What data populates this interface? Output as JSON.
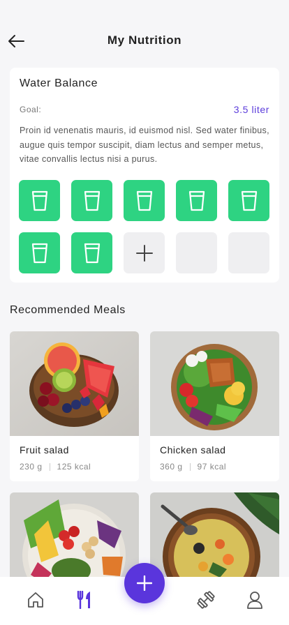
{
  "header": {
    "title": "My Nutrition",
    "back_icon": "arrow-left-icon"
  },
  "water": {
    "title": "Water Balance",
    "goal_label": "Goal:",
    "goal_value": "3.5 liter",
    "description": "Proin id venenatis mauris, id euismod nisl. Sed water finibus, augue quis tempor suscipit, diam lectus and semper metus, vitae convallis lectus nisi a purus.",
    "glasses_filled": 7,
    "glasses_total": 10,
    "add_icon": "plus-icon",
    "accent_color": "#2ed382",
    "goal_color": "#5b3cdb"
  },
  "meals": {
    "section_title": "Recommended Meals",
    "items": [
      {
        "name": "Fruit salad",
        "weight": "230 g",
        "calories": "125 kcal"
      },
      {
        "name": "Chicken salad",
        "weight": "360 g",
        "calories": "97 kcal"
      },
      {
        "name": "",
        "weight": "",
        "calories": ""
      },
      {
        "name": "",
        "weight": "",
        "calories": ""
      }
    ]
  },
  "nav": {
    "items": [
      "home-icon",
      "cutlery-icon",
      "dumbbell-icon",
      "user-icon"
    ],
    "active": "cutlery-icon",
    "fab_icon": "plus-icon",
    "primary_color": "#5a35dc"
  }
}
